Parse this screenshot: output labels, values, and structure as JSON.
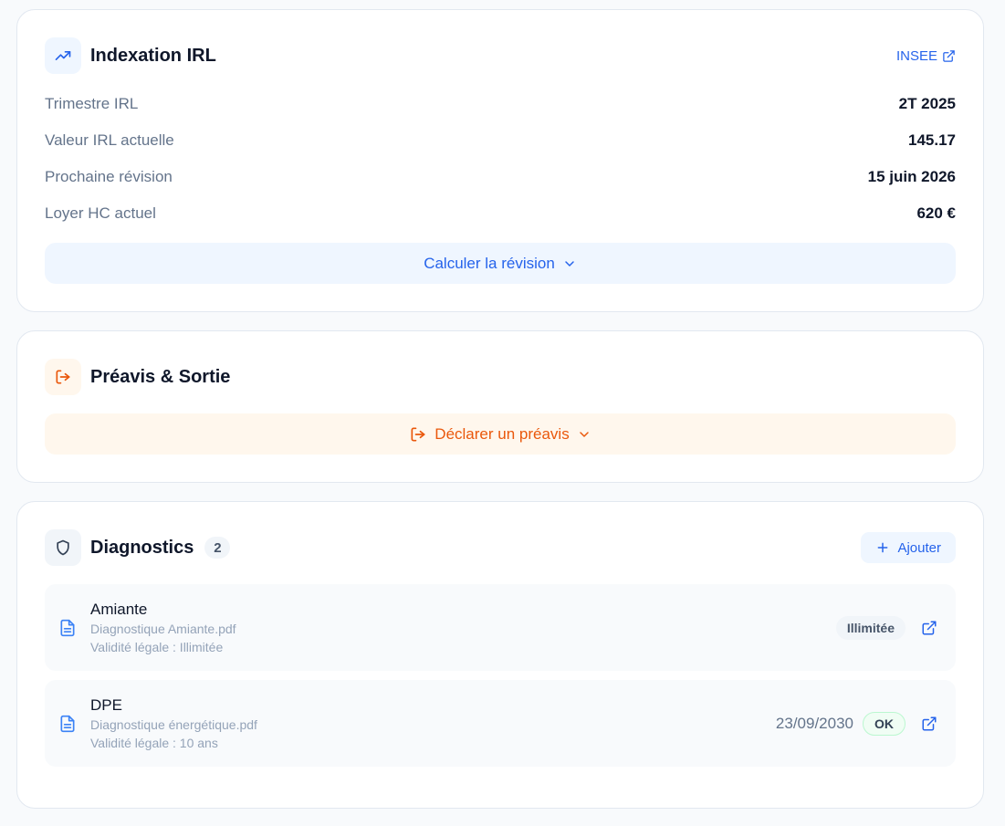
{
  "irl": {
    "title": "Indexation IRL",
    "source_link": "INSEE",
    "rows": [
      {
        "label": "Trimestre IRL",
        "value": "2T 2025"
      },
      {
        "label": "Valeur IRL actuelle",
        "value": "145.17"
      },
      {
        "label": "Prochaine révision",
        "value": "15 juin 2026"
      },
      {
        "label": "Loyer HC actuel",
        "value": "620 €"
      }
    ],
    "calc_button": "Calculer la révision"
  },
  "preavis": {
    "title": "Préavis & Sortie",
    "declare_button": "Déclarer un préavis"
  },
  "diagnostics": {
    "title": "Diagnostics",
    "count": "2",
    "add_button": "Ajouter",
    "items": [
      {
        "name": "Amiante",
        "file": "Diagnostique Amiante.pdf",
        "validity": "Validité légale : Illimitée",
        "date": "",
        "status": "Illimitée"
      },
      {
        "name": "DPE",
        "file": "Diagnostique énergétique.pdf",
        "validity": "Validité légale : 10 ans",
        "date": "23/09/2030",
        "status": "OK"
      }
    ]
  },
  "colors": {
    "accent_blue": "#2563eb",
    "accent_orange": "#ea580c",
    "card_border": "#e2e8f0"
  }
}
